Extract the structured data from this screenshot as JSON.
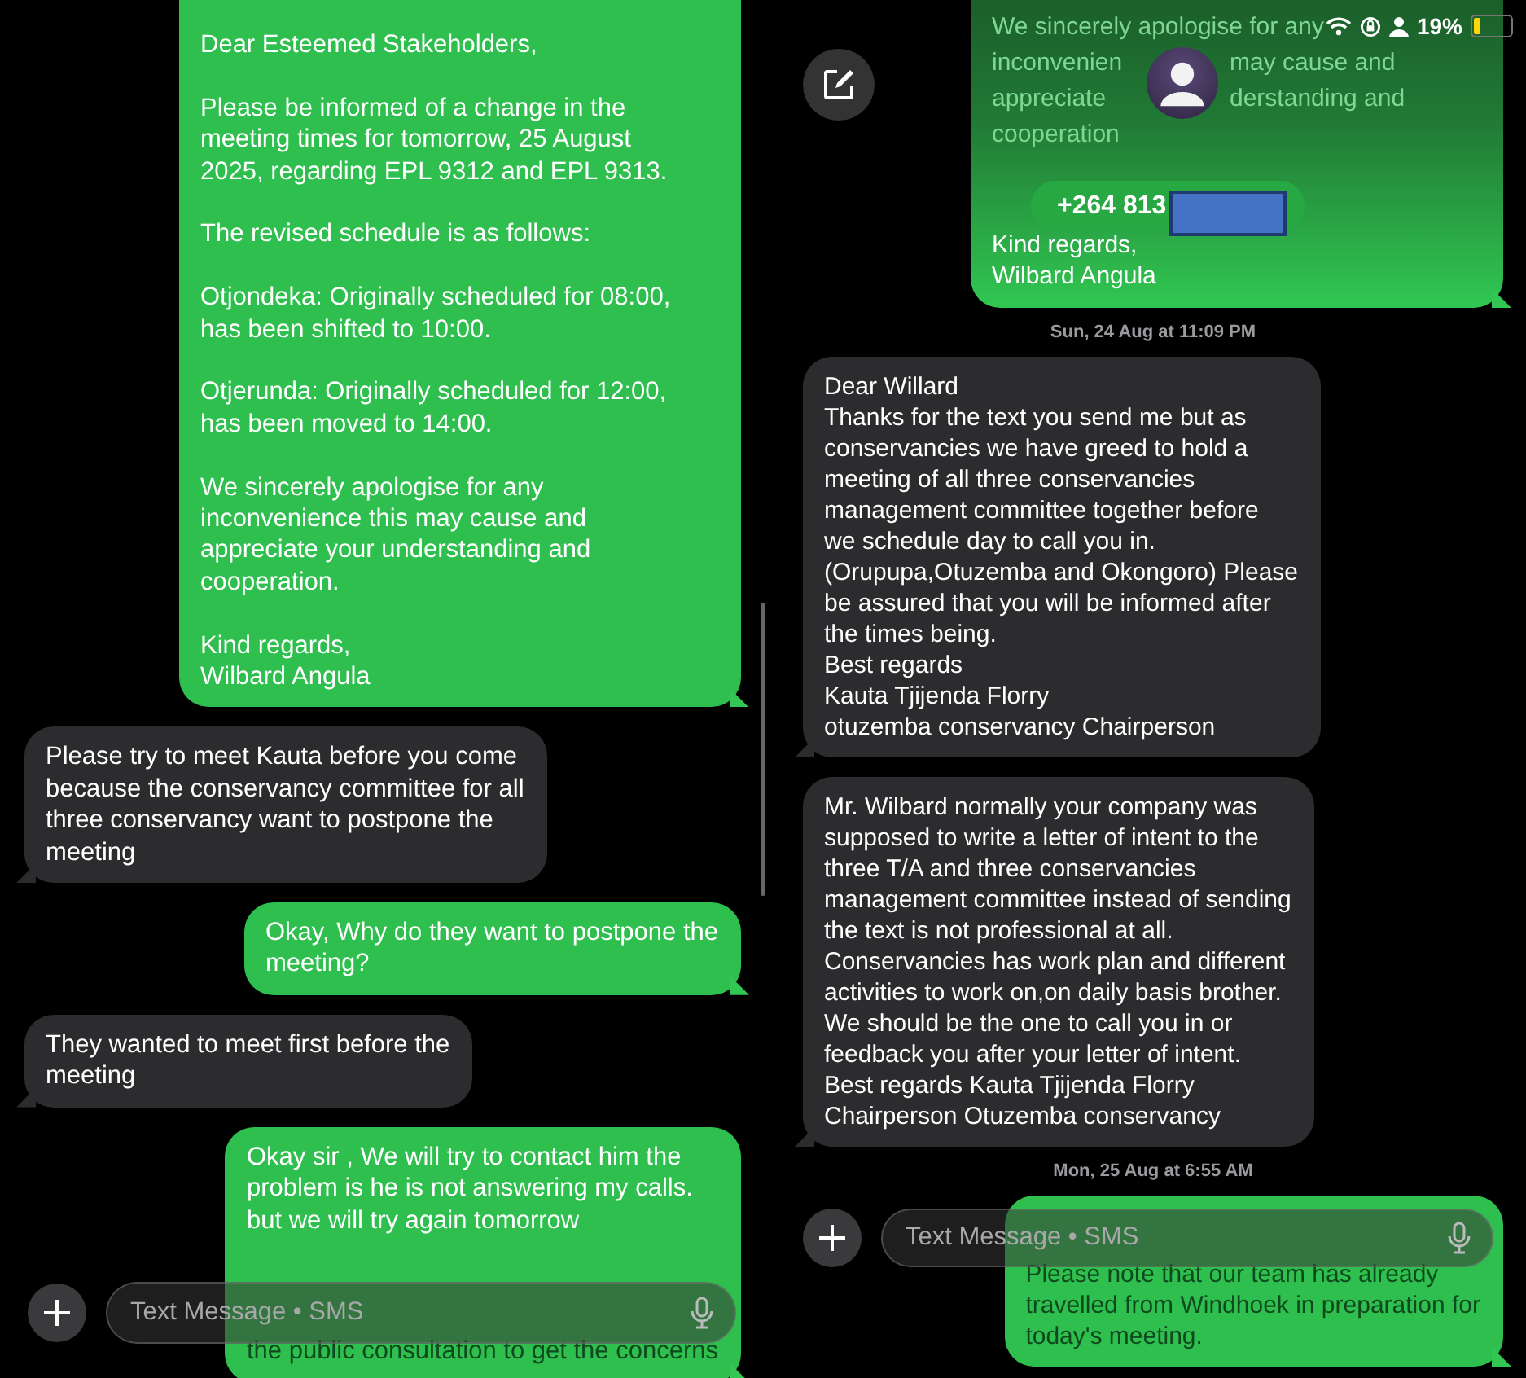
{
  "left_panel": {
    "messages": [
      {
        "kind": "outgoing",
        "paragraphs": [
          {
            "kind": "text",
            "dimmed": false,
            "lines": [
              "Dear Esteemed Stakeholders,"
            ]
          },
          {
            "kind": "text",
            "dimmed": false,
            "lines": [
              "Please be informed of a change in the",
              "meeting times for tomorrow, 25 August",
              "2025, regarding EPL 9312 and EPL 9313."
            ]
          },
          {
            "kind": "text",
            "dimmed": false,
            "lines": [
              "The revised schedule is as follows:"
            ]
          },
          {
            "kind": "text",
            "dimmed": false,
            "lines": [
              "Otjondeka: Originally scheduled for 08:00,",
              "has been shifted to 10:00."
            ]
          },
          {
            "kind": "text",
            "dimmed": false,
            "lines": [
              "Otjerunda: Originally scheduled for 12:00,",
              "has been moved to 14:00."
            ]
          },
          {
            "kind": "text",
            "dimmed": false,
            "lines": [
              "We sincerely apologise for any",
              "inconvenience this may cause and",
              "appreciate your understanding and",
              "cooperation."
            ]
          },
          {
            "kind": "text",
            "dimmed": false,
            "lines": [
              "Kind regards,",
              "Wilbard Angula"
            ]
          }
        ]
      },
      {
        "kind": "incoming",
        "paragraphs": [
          {
            "kind": "text",
            "dimmed": false,
            "lines": [
              "Please try to meet Kauta before you come",
              "because the conservancy committee for all",
              "three conservancy want to postpone the",
              "meeting"
            ]
          }
        ]
      },
      {
        "kind": "outgoing",
        "paragraphs": [
          {
            "kind": "text",
            "dimmed": false,
            "lines": [
              "Okay, Why do they want to postpone the",
              "meeting?"
            ]
          }
        ]
      },
      {
        "kind": "incoming",
        "paragraphs": [
          {
            "kind": "text",
            "dimmed": false,
            "lines": [
              "They wanted to meet first before the",
              "meeting"
            ]
          }
        ]
      },
      {
        "kind": "outgoing",
        "paragraphs": [
          {
            "kind": "text",
            "dimmed": false,
            "lines": [
              "Okay sir , We will try to contact him the",
              "problem is  he is not answering my calls.",
              "but we will try again tomorrow"
            ]
          },
          {
            "kind": "covered"
          },
          {
            "kind": "text",
            "dimmed": true,
            "lines": [
              "the public consultation to get the concerns"
            ]
          }
        ]
      }
    ],
    "composer": {
      "placeholder": "Text Message • SMS"
    }
  },
  "right_panel": {
    "status_bar": {
      "battery_text": "19%",
      "battery": {
        "level": 0.19
      }
    },
    "messages": [
      {
        "kind": "outgoing",
        "paragraphs": [
          {
            "kind": "text",
            "dimmed": true,
            "lines": [
              [
                "We sincerely apologise for any"
              ],
              [
                "inconvenien",
                "may cause and"
              ],
              [
                "appreciate",
                "derstanding and"
              ],
              [
                "cooperation"
              ]
            ]
          },
          {
            "kind": "contact",
            "phone": "+264 813"
          },
          {
            "kind": "text",
            "dimmed": false,
            "lines": [
              "Kind regards,",
              "Wilbard Angula"
            ]
          }
        ]
      },
      {
        "kind": "timestamp",
        "text": "Sun, 24 Aug at 11:09 PM"
      },
      {
        "kind": "incoming",
        "paragraphs": [
          {
            "kind": "text",
            "dimmed": false,
            "lines": [
              "Dear Willard",
              "Thanks for the text you send  me but as",
              "conservancies we have greed to hold a",
              "meeting of all three  conservancies",
              "management committee together before",
              "we schedule day to call you in.",
              "(Orupupa,Otuzemba and Okongoro) Please",
              "be assured that you will be informed after",
              "the times being.",
              "Best regards",
              "Kauta Tjijenda Florry",
              "otuzemba conservancy Chairperson"
            ]
          }
        ]
      },
      {
        "kind": "incoming",
        "paragraphs": [
          {
            "kind": "text",
            "dimmed": false,
            "lines": [
              "Mr. Wilbard normally your company was",
              "supposed to write a letter of intent to the",
              "three T/A and three conservancies",
              "management committee instead of sending",
              "the text is not professional at all.",
              "Conservancies has work plan and different",
              "activities to work on,on daily basis brother.",
              "We should be the one to call you in or",
              "feedback you after your letter of intent.",
              "Best regards Kauta Tjijenda Florry",
              "Chairperson Otuzemba conservancy"
            ]
          }
        ]
      },
      {
        "kind": "timestamp",
        "text": "Mon, 25 Aug at 6:55 AM"
      },
      {
        "kind": "outgoing",
        "paragraphs": [
          {
            "kind": "covered"
          },
          {
            "kind": "text",
            "dimmed": true,
            "lines": [
              "Please note that our team has already",
              "travelled from Windhoek in preparation for",
              "today's meeting."
            ]
          }
        ]
      }
    ],
    "composer": {
      "placeholder": "Text Message • SMS"
    }
  }
}
